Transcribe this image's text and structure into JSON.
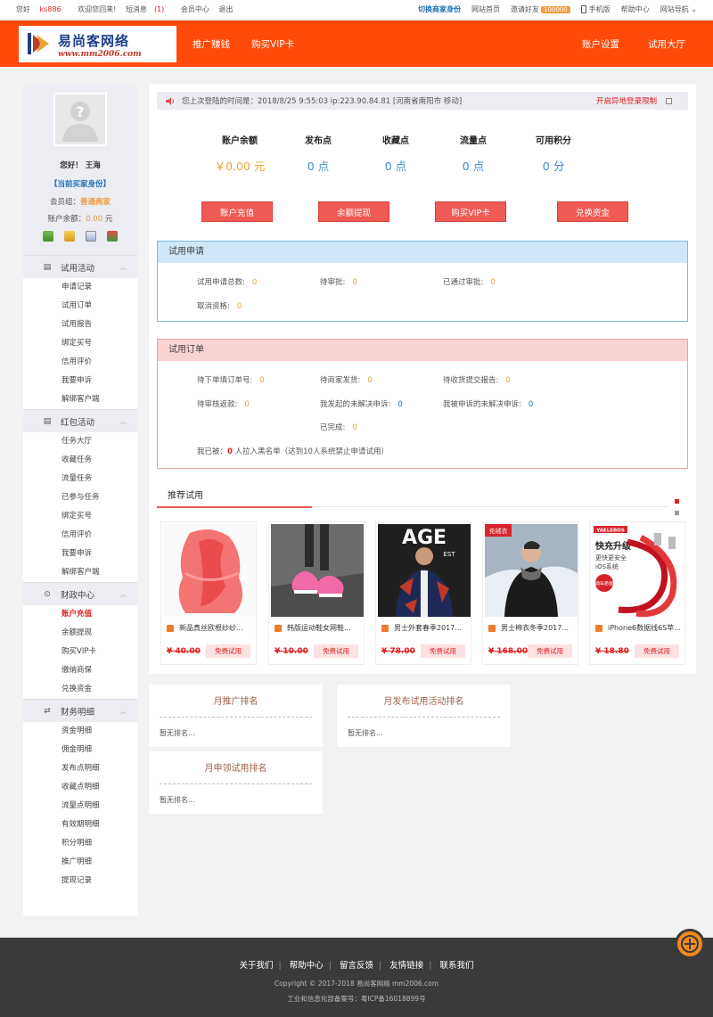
{
  "topbar": {
    "hello": "您好",
    "username": "ks886",
    "welcome": "欢迎您回来!",
    "msg_label": "短消息",
    "msg_count": "(1)",
    "member_center": "会员中心",
    "logout": "退出",
    "switch_role": "切换商家身份",
    "site_home": "网站首页",
    "invite": "邀请好友",
    "invite_badge": "100000",
    "mobile": "手机版",
    "help": "帮助中心",
    "site_nav": "网站导航 ⌄"
  },
  "header": {
    "logo_title": "易尚客网络",
    "logo_url": "www.mm2006.com",
    "nav_left": [
      "推广赚钱",
      "购买VIP卡"
    ],
    "nav_right": [
      "账户设置",
      "试用大厅"
    ]
  },
  "profile": {
    "greeting": "您好！ 王海",
    "role": "【当前买家身份】",
    "group_label": "会员组：",
    "group_value": "普通商家",
    "balance_label": "账户余额：",
    "balance_value": "0.00",
    "balance_unit": " 元"
  },
  "sidebar": {
    "groups": [
      {
        "title": "试用活动",
        "items": [
          "申请记录",
          "试用订单",
          "试用报告",
          "绑定买号",
          "信用评价",
          "我要申诉",
          "解绑客户端"
        ]
      },
      {
        "title": "红包活动",
        "items": [
          "任务大厅",
          "收藏任务",
          "流量任务",
          "已参与任务",
          "绑定买号",
          "信用评价",
          "我要申诉",
          "解绑客户端"
        ]
      },
      {
        "title": "财政中心",
        "items": [
          "账户充值",
          "余额提现",
          "购买VIP卡",
          "缴纳商保",
          "兑换资金"
        ]
      },
      {
        "title": "财务明细",
        "items": [
          "资金明细",
          "佣金明细",
          "发布点明细",
          "收藏点明细",
          "流量点明细",
          "有效期明细",
          "积分明细",
          "推广明细",
          "提现记录"
        ]
      }
    ]
  },
  "login_bar": {
    "text": "您上次登陆的时间是：2018/8/25 9:55:03   ip:223.90.84.81 [河南省南阳市 移动]",
    "limit": "开启异地登录限制"
  },
  "stats": [
    {
      "label": "账户余额",
      "value": "￥0.00 元"
    },
    {
      "label": "发布点",
      "value": "0 点"
    },
    {
      "label": "收藏点",
      "value": "0 点"
    },
    {
      "label": "流量点",
      "value": "0 点"
    },
    {
      "label": "可用积分",
      "value": "0 分"
    }
  ],
  "buttons": [
    "账户充值",
    "余额提现",
    "购买VIP卡",
    "兑换资金"
  ],
  "apply_panel": {
    "title": "试用申请",
    "total": "试用申请总数:",
    "total_v": "0",
    "pending": "待审批:",
    "pending_v": "0",
    "passed": "已通过审批:",
    "passed_v": "0",
    "cancel": "取消资格:",
    "cancel_v": "0"
  },
  "order_panel": {
    "title": "试用订单",
    "c1": "待下单填订单号:",
    "c1_v": "0",
    "c2": "待商家发货:",
    "c2_v": "0",
    "c3": "待收货提交报告:",
    "c3_v": "0",
    "c4": "待审核返款:",
    "c4_v": "0",
    "c5": "我发起的未解决申诉:",
    "c5_v": "0",
    "c6": "我被申诉的未解决申诉:",
    "c6_v": "0",
    "c7": "已完成:",
    "c7_v": "0",
    "blk_a": "我已被：",
    "blk_v": "0",
    "blk_b": "人拉入黑名单（达到10人系统禁止申请试用）"
  },
  "recommend": {
    "tab": "推荐试用",
    "free_label": "免费试用",
    "products": [
      {
        "title": "新品真丝欧根纱纱...",
        "price": "¥ 40.00"
      },
      {
        "title": "韩版运动鞋女网鞋...",
        "price": "¥ 10.00"
      },
      {
        "title": "男士外套春季2017...",
        "price": "¥ 78.00"
      },
      {
        "title": "男士棉衣冬季2017...",
        "price": "¥ 168.00"
      },
      {
        "title": "iPhone6数据线6S苹...",
        "price": "¥ 18.80"
      }
    ],
    "p5_brand": "YAELEBOS",
    "p5_line1": "快充升级",
    "p5_line2": "更快更安全",
    "p5_line3": "iOS系统",
    "p5_tag": "两年质保",
    "p4_tag": "充绒衣",
    "p3_word": "AGE",
    "p3_sub": "EST"
  },
  "ranks": [
    {
      "title": "月推广排名",
      "empty": "暂无排名..."
    },
    {
      "title": "月发布试用活动排名",
      "empty": "暂无排名..."
    },
    {
      "title": "月申领试用排名",
      "empty": "暂无排名..."
    }
  ],
  "footer": {
    "links": [
      "关于我们",
      "帮助中心",
      "留言反馈",
      "友情链接",
      "联系我们"
    ],
    "copyright": "Copyright © 2017-2018 易尚客网络  mm2006.com",
    "icp": "工业和信息化部备案号：粤ICP备16018899号"
  },
  "colors": {
    "brand": "#ff4a0a",
    "accent_red": "#ef5a55",
    "blue": "#3b8ad1",
    "gold": "#e9a33b"
  }
}
